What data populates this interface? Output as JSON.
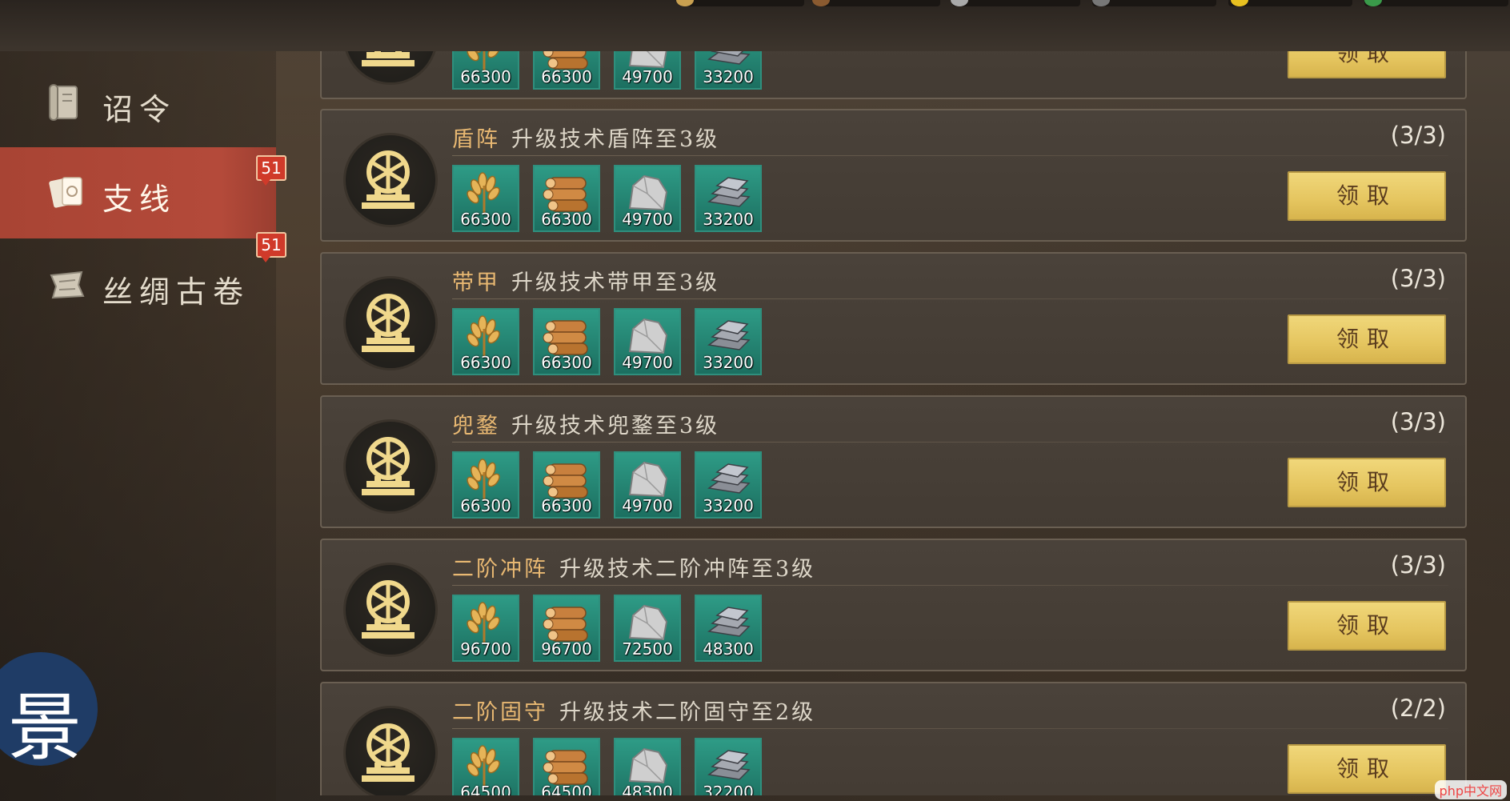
{
  "sidebar": {
    "items": [
      {
        "label": "诏令",
        "icon": "scroll-icon",
        "active": false
      },
      {
        "label": "支线",
        "icon": "cards-icon",
        "active": true,
        "badge": "51"
      },
      {
        "label": "丝绸古卷",
        "icon": "silk-scroll-icon",
        "active": false,
        "badge": "51"
      }
    ]
  },
  "partial_top": {
    "rewards": [
      "66300",
      "66300",
      "49700",
      "33200"
    ],
    "claim": "领取"
  },
  "quests": [
    {
      "name": "盾阵",
      "desc": "升级技术盾阵至3级",
      "progress": "(3/3)",
      "rewards": [
        "66300",
        "66300",
        "49700",
        "33200"
      ],
      "claim": "领取"
    },
    {
      "name": "带甲",
      "desc": "升级技术带甲至3级",
      "progress": "(3/3)",
      "rewards": [
        "66300",
        "66300",
        "49700",
        "33200"
      ],
      "claim": "领取"
    },
    {
      "name": "兜鍪",
      "desc": "升级技术兜鍪至3级",
      "progress": "(3/3)",
      "rewards": [
        "66300",
        "66300",
        "49700",
        "33200"
      ],
      "claim": "领取"
    },
    {
      "name": "二阶冲阵",
      "desc": "升级技术二阶冲阵至3级",
      "progress": "(3/3)",
      "rewards": [
        "96700",
        "96700",
        "72500",
        "48300"
      ],
      "claim": "领取"
    },
    {
      "name": "二阶固守",
      "desc": "升级技术二阶固守至2级",
      "progress": "(2/2)",
      "rewards": [
        "64500",
        "64500",
        "48300",
        "32200"
      ],
      "claim": "领取"
    }
  ],
  "reward_icons": [
    "wheat-icon",
    "wood-logs-icon",
    "stone-icon",
    "iron-ingot-icon"
  ],
  "colors": {
    "accent_active": "#b44a3a",
    "claim_button": "#e5c55f",
    "reward_bg": "#2e9b86",
    "title": "#e8b872"
  },
  "logo": {
    "glyph": "景"
  },
  "watermark": "php中文网"
}
